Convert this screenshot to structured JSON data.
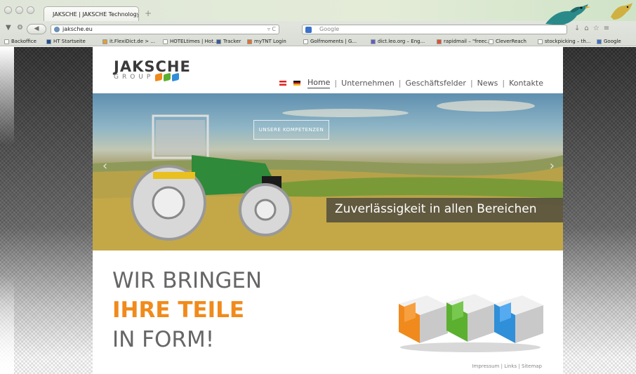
{
  "browser": {
    "tab_title": "JAKSCHE | JAKSCHE Technology",
    "tab_new": "+",
    "url": "jaksche.eu",
    "search_placeholder": "Google",
    "bookmarks": [
      {
        "label": "Backoffice",
        "color": "#ffffff"
      },
      {
        "label": "HT Startseite",
        "color": "#1f4f9a"
      },
      {
        "label": "it.FlexiDict.de > ...",
        "color": "#e0a030"
      },
      {
        "label": "HOTELtimes | Hot...",
        "color": "#ffffff"
      },
      {
        "label": "Tracker",
        "color": "#3a5a9a"
      },
      {
        "label": "myTNT Login",
        "color": "#e07030"
      },
      {
        "label": "Golfmoments | G...",
        "color": "#ffffff"
      },
      {
        "label": "dict.leo.org – Eng...",
        "color": "#6060c0"
      },
      {
        "label": "rapidmail – \"freec...",
        "color": "#e05030"
      },
      {
        "label": "CleverReach",
        "color": "#ffffff"
      },
      {
        "label": "stockpicking – th...",
        "color": "#ffffff"
      },
      {
        "label": "Google",
        "color": "#3a72c8"
      }
    ]
  },
  "site": {
    "logo_main": "JAKSCHE",
    "logo_sub": "GROUP",
    "nav": [
      "Home",
      "Unternehmen",
      "Geschäftsfelder",
      "News",
      "Kontakte"
    ],
    "nav_separator": "|",
    "hero_button": "UNSERE KOMPETENZEN",
    "hero_caption": "Zuverlässigkeit in allen Bereichen",
    "slogan_line1": "WIR BRINGEN",
    "slogan_line2": "IHRE TEILE",
    "slogan_line3": "IN FORM!",
    "footer_links": [
      "Impressum",
      "Links",
      "Sitemap"
    ],
    "colors": {
      "accent_orange": "#f08a1c",
      "cube_orange": "#f08a1c",
      "cube_green": "#5cb030",
      "cube_blue": "#2f8fd8",
      "tractor_green": "#2f8a3a",
      "tractor_yellow": "#e8c020"
    }
  }
}
